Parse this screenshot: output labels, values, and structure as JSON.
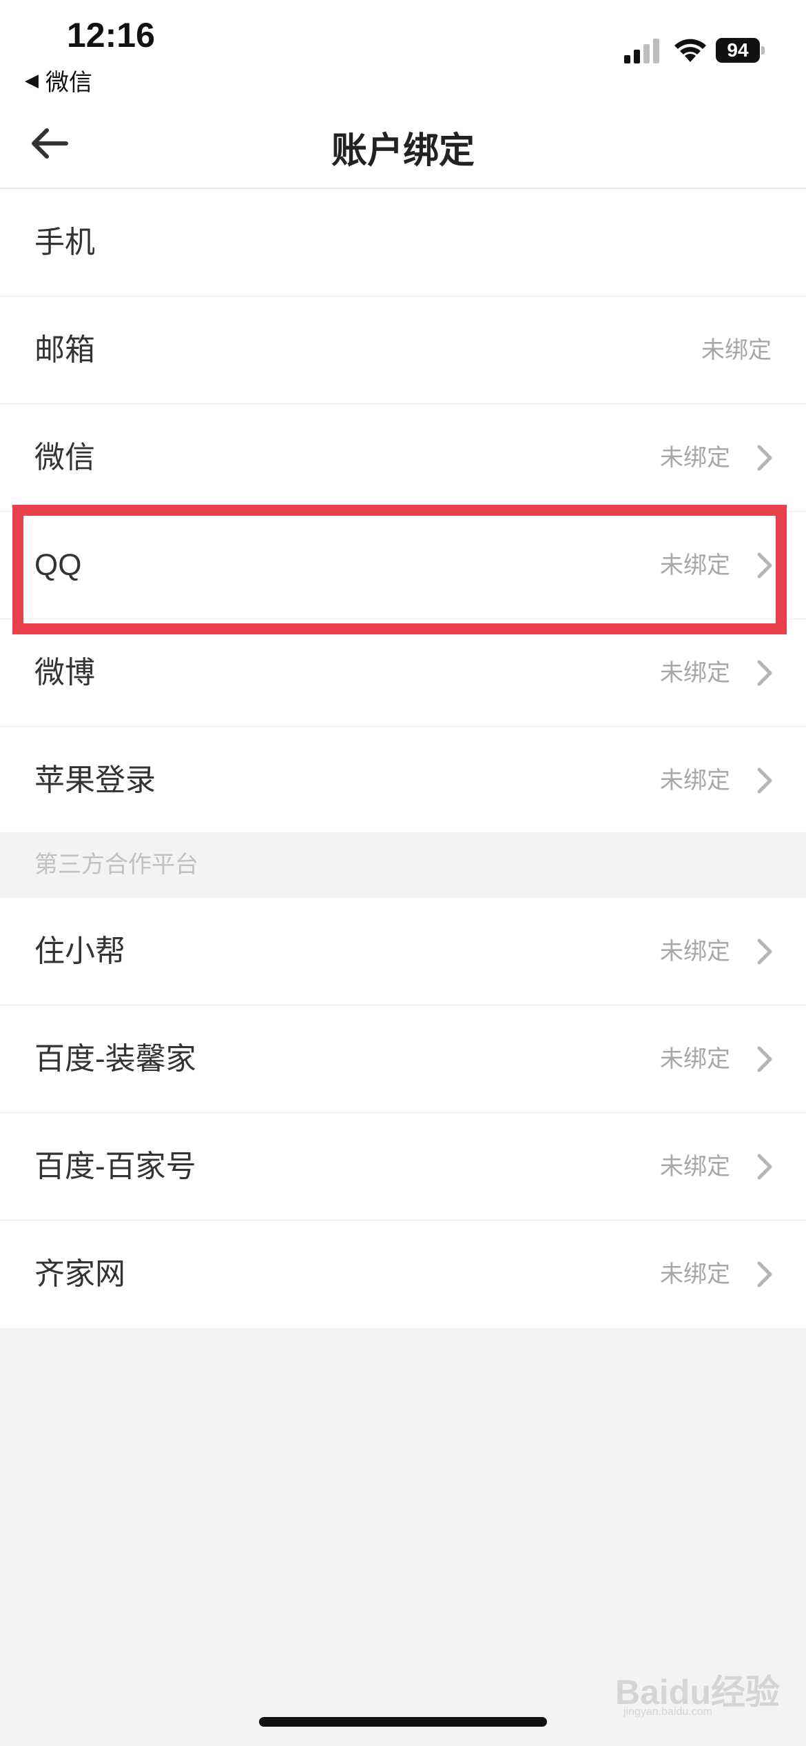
{
  "status_bar": {
    "time": "12:16",
    "back_app_label": "微信",
    "battery_level": "94"
  },
  "nav": {
    "title": "账户绑定"
  },
  "accounts": [
    {
      "label": "手机",
      "status": ""
    },
    {
      "label": "邮箱",
      "status": "未绑定"
    },
    {
      "label": "微信",
      "status": "未绑定"
    },
    {
      "label": "QQ",
      "status": "未绑定"
    },
    {
      "label": "微博",
      "status": "未绑定"
    },
    {
      "label": "苹果登录",
      "status": "未绑定"
    }
  ],
  "third_party_section": {
    "title": "第三方合作平台",
    "items": [
      {
        "label": "住小帮",
        "status": "未绑定"
      },
      {
        "label": "百度-装馨家",
        "status": "未绑定"
      },
      {
        "label": "百度-百家号",
        "status": "未绑定"
      },
      {
        "label": "齐家网",
        "status": "未绑定"
      }
    ]
  },
  "watermark": {
    "logo": "Baidu经验",
    "sub": "jingyan.baidu.com"
  },
  "colors": {
    "highlight": "#e8414b",
    "background": "#f2f3f5",
    "status_text": "#a7a7a7"
  }
}
